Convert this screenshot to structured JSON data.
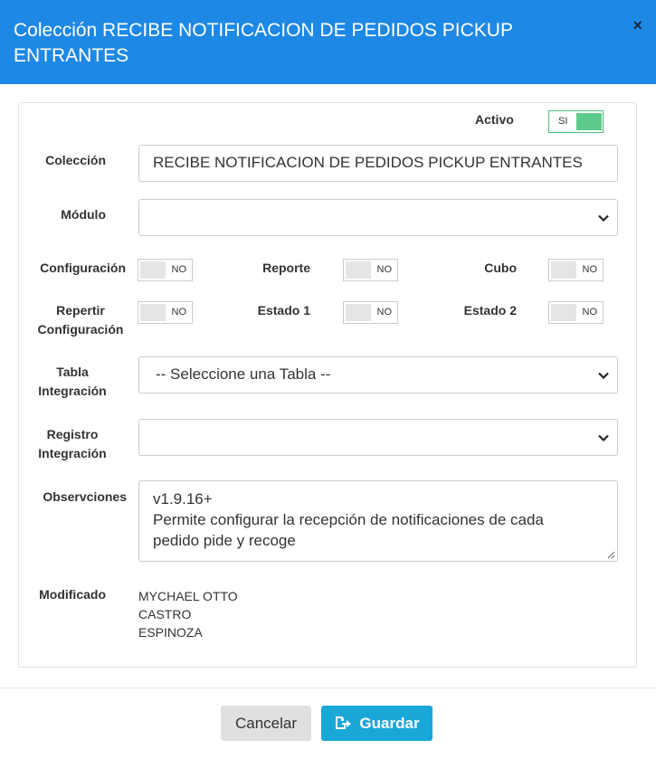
{
  "modal": {
    "title": "Colección RECIBE NOTIFICACION DE PEDIDOS PICKUP ENTRANTES",
    "close_icon": "close-icon",
    "close_symbol": "×"
  },
  "form": {
    "activo": {
      "label": "Activo",
      "value": "SI",
      "on": true
    },
    "coleccion": {
      "label": "Colección",
      "value": "RECIBE NOTIFICACION DE PEDIDOS PICKUP ENTRANTES"
    },
    "modulo": {
      "label": "Módulo",
      "value": ""
    },
    "configuracion": {
      "label": "Configuración",
      "value": "NO"
    },
    "reporte": {
      "label": "Reporte",
      "value": "NO"
    },
    "cubo": {
      "label": "Cubo",
      "value": "NO"
    },
    "repertir_configuracion": {
      "label_line1": "Repertir",
      "label_line2": "Configuración",
      "value": "NO"
    },
    "estado1": {
      "label": "Estado 1",
      "value": "NO"
    },
    "estado2": {
      "label": "Estado 2",
      "value": "NO"
    },
    "tabla_integracion": {
      "label_line1": "Tabla",
      "label_line2": "Integración",
      "value": "-- Seleccione una Tabla --"
    },
    "registro_integracion": {
      "label_line1": "Registro",
      "label_line2": "Integración",
      "value": ""
    },
    "observaciones": {
      "label": "Observciones",
      "line1": "v1.9.16+",
      "line2": "Permite configurar la recepción de notificaciones de cada",
      "line3": "pedido pide y recoge"
    },
    "modificado": {
      "label": "Modificado",
      "line1": "MYCHAEL OTTO",
      "line2": "CASTRO",
      "line3": "ESPINOZA"
    }
  },
  "footer": {
    "cancel_label": "Cancelar",
    "save_label": "Guardar",
    "save_icon": "save-share-icon"
  },
  "colors": {
    "header": "#1e88e5",
    "toggle_on": "#5fcb8a",
    "save_button": "#19a7d8"
  }
}
